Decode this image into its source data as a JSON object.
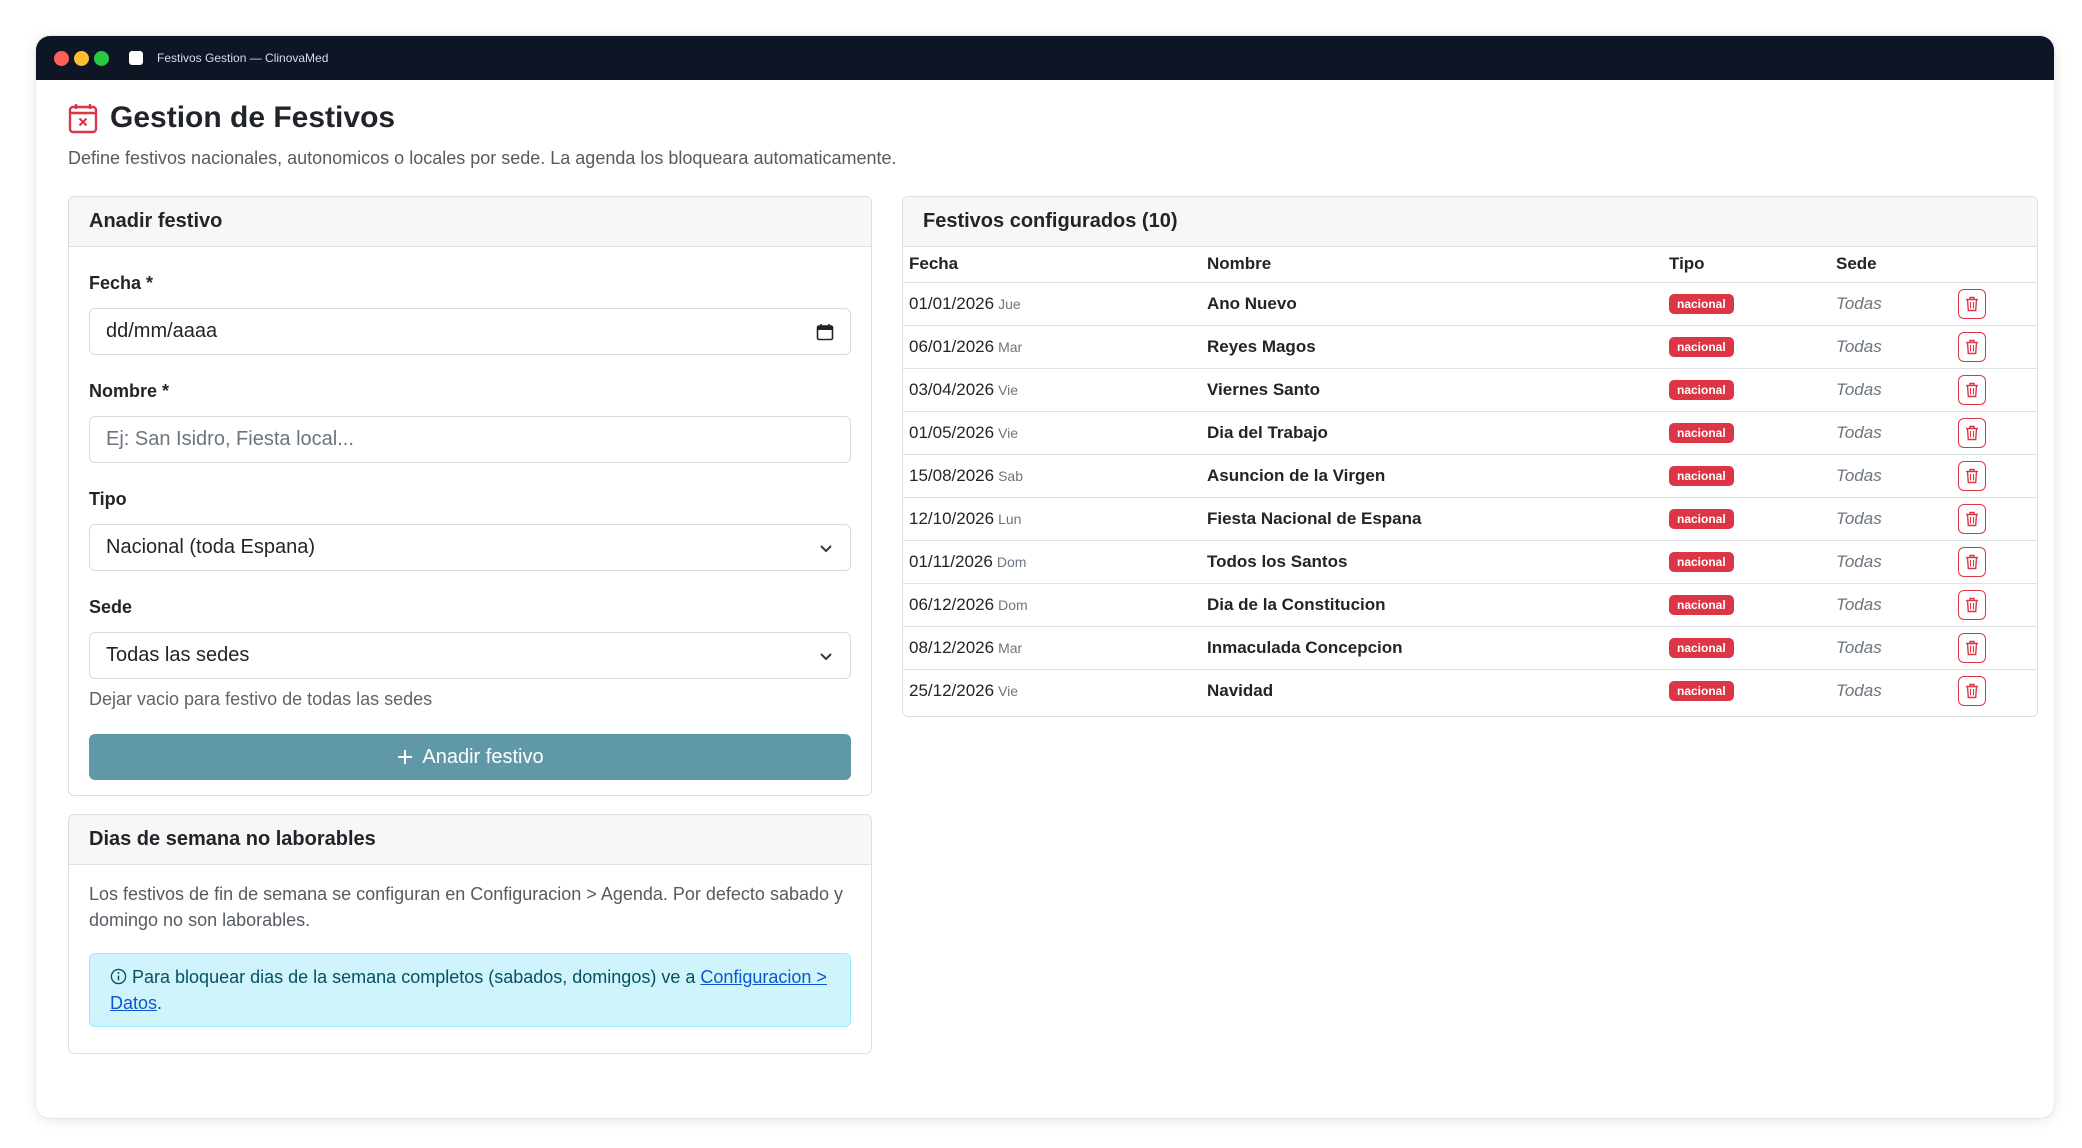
{
  "window": {
    "title": "Festivos Gestion — ClinovaMed"
  },
  "page": {
    "title": "Gestion de Festivos",
    "subtitle": "Define festivos nacionales, autonomicos o locales por sede. La agenda los bloqueara automaticamente."
  },
  "add_form": {
    "header": "Anadir festivo",
    "fecha_label": "Fecha *",
    "fecha_placeholder": "dd/mm/aaaa",
    "nombre_label": "Nombre *",
    "nombre_placeholder": "Ej: San Isidro, Fiesta local...",
    "tipo_label": "Tipo",
    "tipo_value": "Nacional (toda Espana)",
    "sede_label": "Sede",
    "sede_value": "Todas las sedes",
    "sede_hint": "Dejar vacio para festivo de todas las sedes",
    "submit_label": "Anadir festivo"
  },
  "weekdays_card": {
    "header": "Dias de semana no laborables",
    "text": "Los festivos de fin de semana se configuran en Configuracion > Agenda. Por defecto sabado y domingo no son laborables.",
    "alert_text": "Para bloquear dias de la semana completos (sabados, domingos) ve a",
    "alert_link": "Configuracion > Datos",
    "alert_end": "."
  },
  "table_card": {
    "header": "Festivos configurados (10)",
    "columns": [
      "Fecha",
      "Nombre",
      "Tipo",
      "Sede"
    ],
    "rows": [
      {
        "date": "01/01/2026",
        "dow": "Jue",
        "name": "Ano Nuevo",
        "tipo": "nacional",
        "sede": "Todas"
      },
      {
        "date": "06/01/2026",
        "dow": "Mar",
        "name": "Reyes Magos",
        "tipo": "nacional",
        "sede": "Todas"
      },
      {
        "date": "03/04/2026",
        "dow": "Vie",
        "name": "Viernes Santo",
        "tipo": "nacional",
        "sede": "Todas"
      },
      {
        "date": "01/05/2026",
        "dow": "Vie",
        "name": "Dia del Trabajo",
        "tipo": "nacional",
        "sede": "Todas"
      },
      {
        "date": "15/08/2026",
        "dow": "Sab",
        "name": "Asuncion de la Virgen",
        "tipo": "nacional",
        "sede": "Todas"
      },
      {
        "date": "12/10/2026",
        "dow": "Lun",
        "name": "Fiesta Nacional de Espana",
        "tipo": "nacional",
        "sede": "Todas"
      },
      {
        "date": "01/11/2026",
        "dow": "Dom",
        "name": "Todos los Santos",
        "tipo": "nacional",
        "sede": "Todas"
      },
      {
        "date": "06/12/2026",
        "dow": "Dom",
        "name": "Dia de la Constitucion",
        "tipo": "nacional",
        "sede": "Todas"
      },
      {
        "date": "08/12/2026",
        "dow": "Mar",
        "name": "Inmaculada Concepcion",
        "tipo": "nacional",
        "sede": "Todas"
      },
      {
        "date": "25/12/2026",
        "dow": "Vie",
        "name": "Navidad",
        "tipo": "nacional",
        "sede": "Todas"
      }
    ]
  },
  "colors": {
    "accent": "#5f99a8",
    "danger": "#dc3545",
    "titlebar": "#0e1525",
    "alert_bg": "#cff4fc"
  },
  "icons": {
    "page": "calendar-x-icon",
    "date_input": "calendar-icon",
    "select": "chevron-down-icon",
    "add": "plus-icon",
    "info": "info-circle-icon",
    "delete": "trash-icon"
  }
}
